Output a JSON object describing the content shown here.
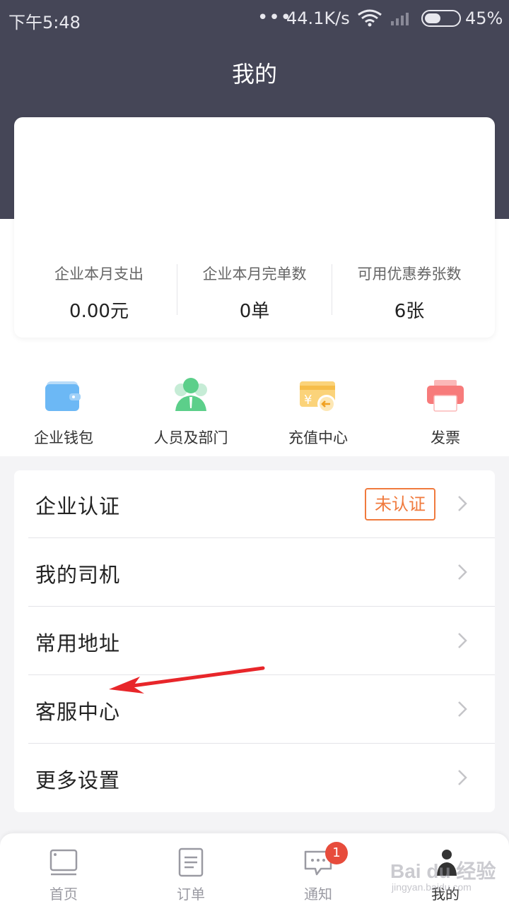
{
  "status_bar": {
    "time": "下午5:48",
    "dots": "•••",
    "speed": "44.1K/s",
    "battery": "45%",
    "battery_level": 0.45
  },
  "header": {
    "title": "我的"
  },
  "stats": [
    {
      "label": "企业本月支出",
      "value": "0.00元"
    },
    {
      "label": "企业本月完单数",
      "value": "0单"
    },
    {
      "label": "可用优惠券张数",
      "value": "6张"
    }
  ],
  "quick_actions": [
    {
      "label": "企业钱包",
      "icon": "wallet-icon"
    },
    {
      "label": "人员及部门",
      "icon": "staff-icon"
    },
    {
      "label": "充值中心",
      "icon": "recharge-icon"
    },
    {
      "label": "发票",
      "icon": "invoice-printer-icon"
    }
  ],
  "menu": [
    {
      "label": "企业认证",
      "badge": "未认证"
    },
    {
      "label": "我的司机"
    },
    {
      "label": "常用地址"
    },
    {
      "label": "客服中心"
    },
    {
      "label": "更多设置"
    }
  ],
  "bottom_nav": [
    {
      "label": "首页",
      "icon": "home-icon"
    },
    {
      "label": "订单",
      "icon": "orders-icon"
    },
    {
      "label": "通知",
      "icon": "message-icon",
      "badge": "1"
    },
    {
      "label": "我的",
      "icon": "profile-icon",
      "active": true
    }
  ],
  "watermark": {
    "text": "Bai du 经验",
    "sub": "jingyan.baidu.com"
  },
  "colors": {
    "header_bg": "#454657",
    "accent_orange": "#f07a3d",
    "badge_red": "#e74c3c",
    "annotation_red": "#e8262a"
  }
}
